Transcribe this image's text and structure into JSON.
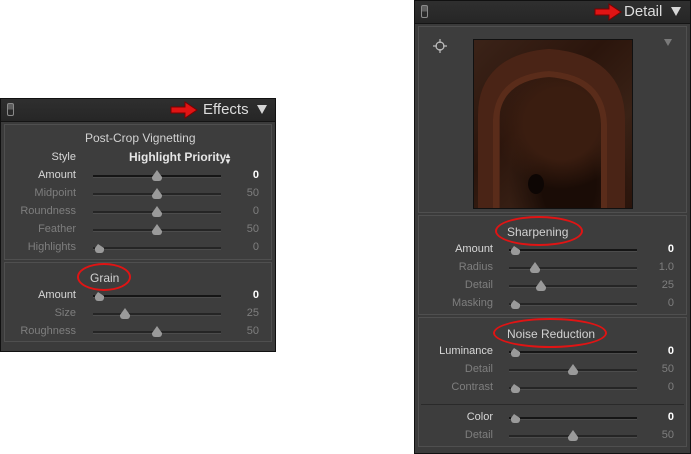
{
  "effects": {
    "title": "Effects",
    "vignette_title": "Post-Crop Vignetting",
    "style_label": "Style",
    "style_value": "Highlight Priority",
    "vignette_sliders": [
      {
        "label": "Amount",
        "value": "0",
        "level": 0.5,
        "active": true
      },
      {
        "label": "Midpoint",
        "value": "50",
        "level": 0.5,
        "active": false
      },
      {
        "label": "Roundness",
        "value": "0",
        "level": 0.5,
        "active": false
      },
      {
        "label": "Feather",
        "value": "50",
        "level": 0.5,
        "active": false
      },
      {
        "label": "Highlights",
        "value": "0",
        "level": 0.0,
        "active": false
      }
    ],
    "grain_title": "Grain",
    "grain_sliders": [
      {
        "label": "Amount",
        "value": "0",
        "level": 0.0,
        "active": true
      },
      {
        "label": "Size",
        "value": "25",
        "level": 0.25,
        "active": false
      },
      {
        "label": "Roughness",
        "value": "50",
        "level": 0.5,
        "active": false
      }
    ]
  },
  "detail": {
    "title": "Detail",
    "sharpening_title": "Sharpening",
    "sharpening_sliders": [
      {
        "label": "Amount",
        "value": "0",
        "level": 0.0,
        "active": true
      },
      {
        "label": "Radius",
        "value": "1.0",
        "level": 0.2,
        "active": false
      },
      {
        "label": "Detail",
        "value": "25",
        "level": 0.25,
        "active": false
      },
      {
        "label": "Masking",
        "value": "0",
        "level": 0.0,
        "active": false
      }
    ],
    "noise_title": "Noise Reduction",
    "noise_sliders": [
      {
        "label": "Luminance",
        "value": "0",
        "level": 0.0,
        "active": true
      },
      {
        "label": "Detail",
        "value": "50",
        "level": 0.5,
        "active": false
      },
      {
        "label": "Contrast",
        "value": "0",
        "level": 0.0,
        "active": false
      }
    ],
    "color_sliders": [
      {
        "label": "Color",
        "value": "0",
        "level": 0.0,
        "active": true
      },
      {
        "label": "Detail",
        "value": "50",
        "level": 0.5,
        "active": false
      }
    ]
  },
  "colors": {
    "annotation_red": "#e01414",
    "panel_bg": "#3b3b3b"
  },
  "icons": {
    "arrow": "red-arrow-icon",
    "collapse": "triangle-down-icon",
    "target": "crosshair-icon"
  }
}
